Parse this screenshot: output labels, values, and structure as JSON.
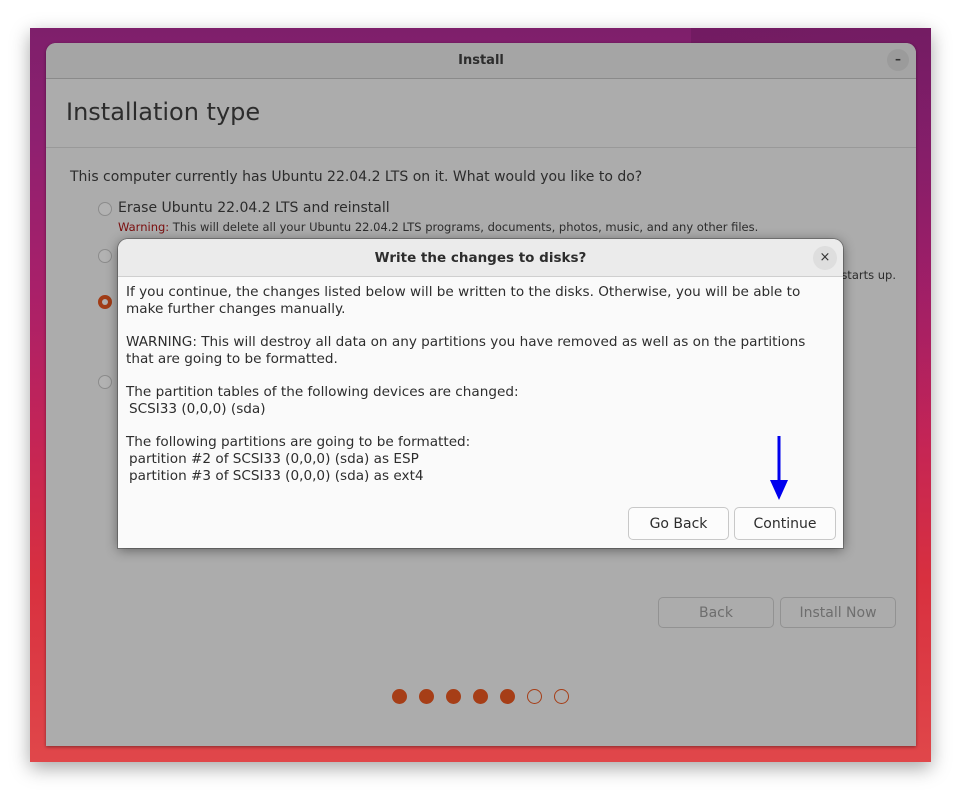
{
  "window": {
    "title": "Install",
    "minimize_label": "–"
  },
  "page": {
    "title": "Installation type",
    "question": "This computer currently has Ubuntu 22.04.2 LTS on it. What would you like to do?",
    "options": [
      {
        "label": "Erase Ubuntu 22.04.2 LTS and reinstall",
        "warning_prefix": "Warning:",
        "description": " This will delete all your Ubuntu 22.04.2 LTS programs, documents, photos, music, and any other files.",
        "selected": false
      },
      {
        "label": "",
        "description": "starts up.",
        "selected": false
      },
      {
        "label": "",
        "description": "",
        "selected": true
      },
      {
        "label": "",
        "description": "",
        "selected": false
      }
    ],
    "back_label": "Back",
    "install_now_label": "Install Now",
    "progress": {
      "total_steps": 7,
      "completed_steps": 5
    }
  },
  "dialog": {
    "title": "Write the changes to disks?",
    "close_label": "×",
    "paragraph1": "If you continue, the changes listed below will be written to the disks. Otherwise, you will be able to make further changes manually.",
    "paragraph2": "WARNING: This will destroy all data on any partitions you have removed as well as on the partitions that are going to be formatted.",
    "tables_heading": "The partition tables of the following devices are changed:",
    "tables_devices": [
      "SCSI33 (0,0,0) (sda)"
    ],
    "format_heading": "The following partitions are going to be formatted:",
    "format_partitions": [
      "partition #2 of SCSI33 (0,0,0) (sda) as ESP",
      "partition #3 of SCSI33 (0,0,0) (sda) as ext4"
    ],
    "go_back_label": "Go Back",
    "continue_label": "Continue"
  },
  "annotation": {
    "arrow_color": "#0000ee",
    "target": "continue"
  },
  "colors": {
    "accent": "#a63e17",
    "warning_text": "#7a0d0d"
  }
}
